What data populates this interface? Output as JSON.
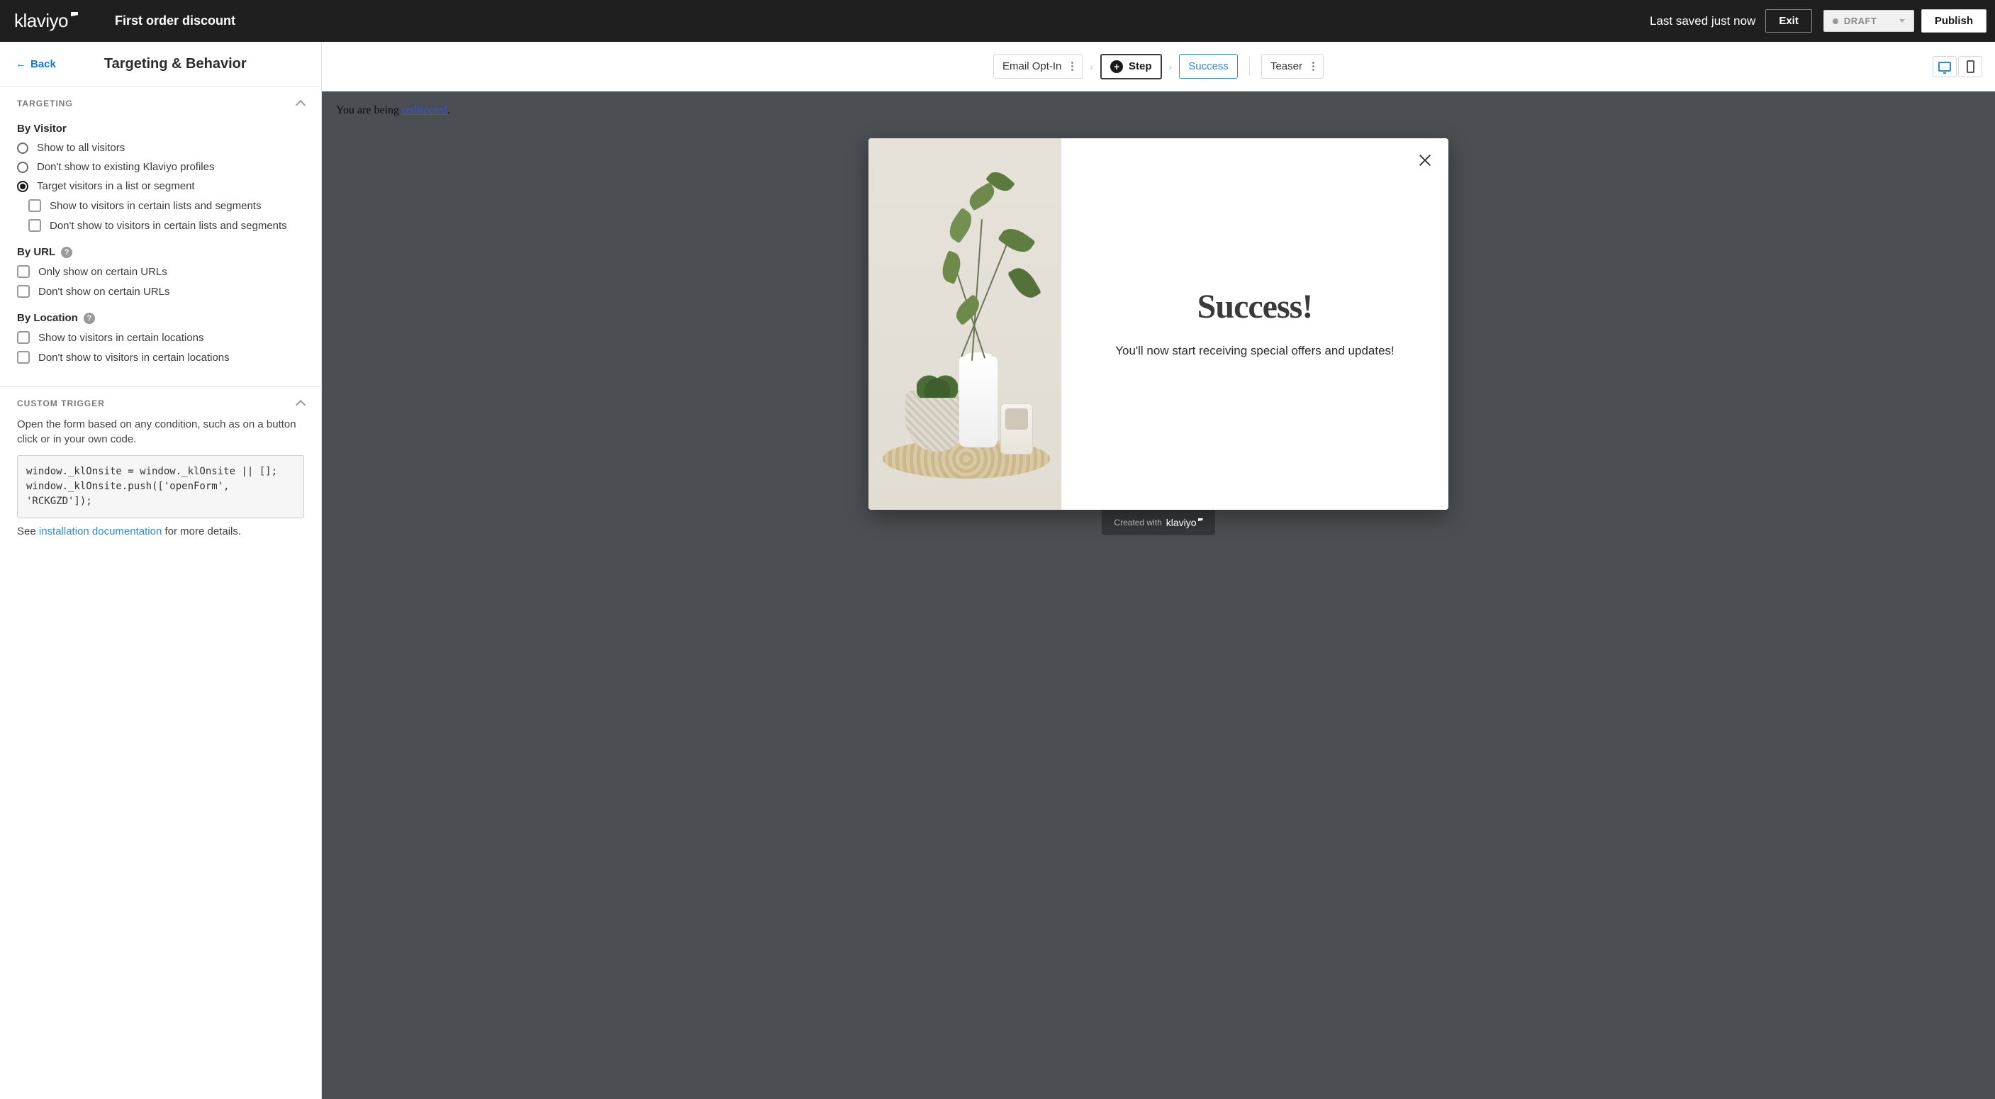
{
  "topbar": {
    "brand": "klaviyo",
    "form_title": "First order discount",
    "last_saved": "Last saved just now",
    "exit": "Exit",
    "status": "DRAFT",
    "publish": "Publish"
  },
  "sidebar": {
    "back": "Back",
    "title": "Targeting & Behavior",
    "targeting": {
      "header": "TARGETING",
      "by_visitor": {
        "title": "By Visitor",
        "opt_all": "Show to all visitors",
        "opt_exclude_profiles": "Don't show to existing Klaviyo profiles",
        "opt_segment": "Target visitors in a list or segment",
        "show_certain": "Show to visitors in certain lists and segments",
        "hide_certain": "Don't show to visitors in certain lists and segments"
      },
      "by_url": {
        "title": "By URL",
        "only_show": "Only show on certain URLs",
        "dont_show": "Don't show on certain URLs"
      },
      "by_location": {
        "title": "By Location",
        "show": "Show to visitors in certain locations",
        "hide": "Don't show to visitors in certain locations"
      }
    },
    "custom_trigger": {
      "header": "CUSTOM TRIGGER",
      "desc": "Open the form based on any condition, such as on a button click or in your own code.",
      "code": "window._klOnsite = window._klOnsite || [];\nwindow._klOnsite.push(['openForm', 'RCKGZD']);",
      "see_prefix": "See ",
      "see_link": "installation documentation",
      "see_suffix": " for more details."
    }
  },
  "steps": {
    "email_optin": "Email Opt-In",
    "add_step": "Step",
    "success": "Success",
    "teaser": "Teaser"
  },
  "canvas": {
    "redirect_prefix": "You are being ",
    "redirect_link": "redirected",
    "redirect_suffix": ".",
    "popup": {
      "heading": "Success!",
      "body": "You'll now start receiving special offers and updates!"
    },
    "created_with": "Created with",
    "created_brand": "klaviyo"
  }
}
